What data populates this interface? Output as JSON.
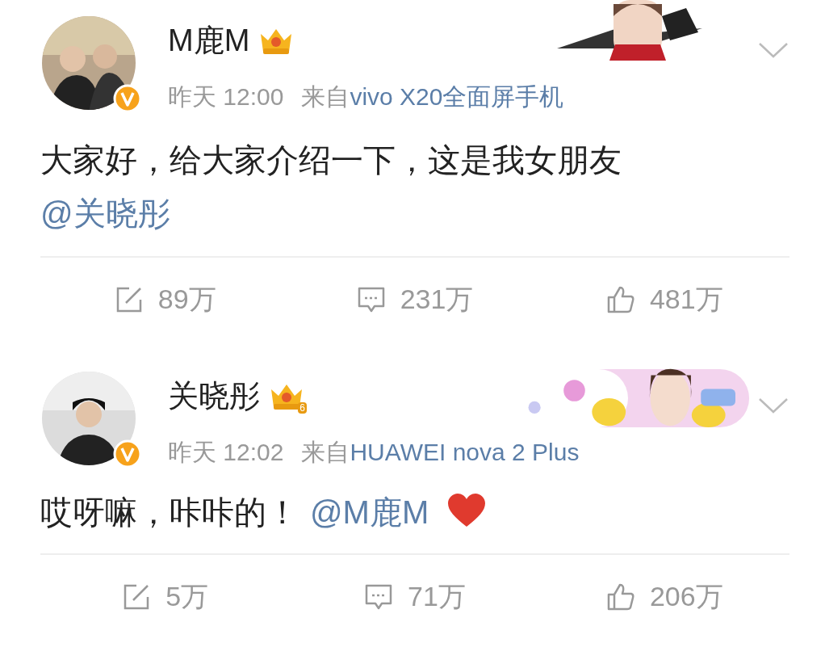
{
  "posts": [
    {
      "user": {
        "name": "M鹿M",
        "verified": true
      },
      "time": "昨天 12:00",
      "via": "来自",
      "source": "vivo X20全面屏手机",
      "text": "大家好，给大家介绍一下，这是我女朋友",
      "mention": "@关晓彤",
      "heart": false,
      "stats": [
        {
          "kind": "repost",
          "count": "89万"
        },
        {
          "kind": "comment",
          "count": "231万"
        },
        {
          "kind": "like",
          "count": "481万"
        }
      ]
    },
    {
      "user": {
        "name": "关晓彤",
        "verified": true,
        "crown_level": "6"
      },
      "time": "昨天 12:02",
      "via": "来自",
      "source": "HUAWEI nova 2 Plus",
      "text": "哎呀嘛，咔咔的！",
      "mention": "@M鹿M",
      "heart": true,
      "stats": [
        {
          "kind": "repost",
          "count": "5万"
        },
        {
          "kind": "comment",
          "count": "71万"
        },
        {
          "kind": "like",
          "count": "206万"
        }
      ]
    }
  ]
}
